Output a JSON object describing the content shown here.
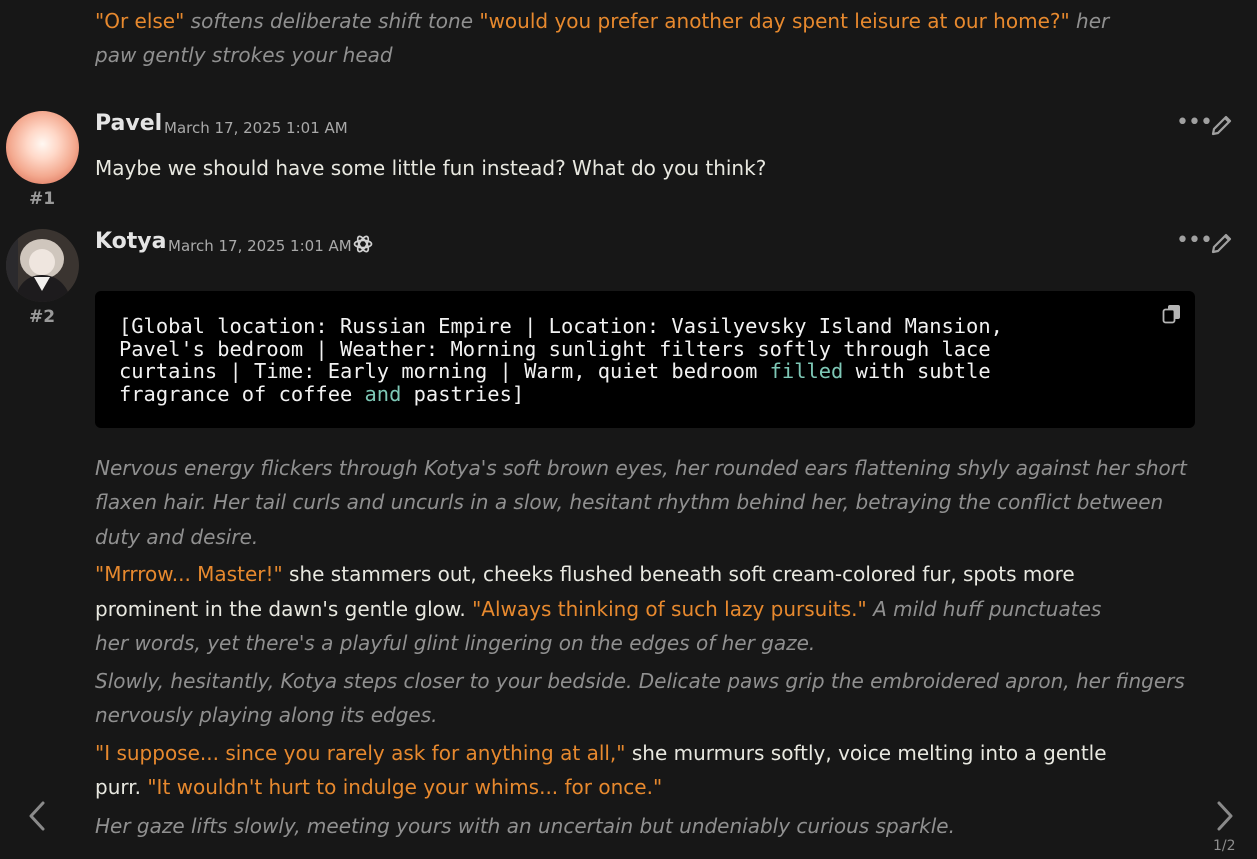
{
  "prev_message": {
    "line1": {
      "q1": "\"Or else\"",
      "n1": " softens deliberate shift tone ",
      "q2": "\"would you prefer another day spent leisure at our home?\"",
      "n2": " her"
    },
    "line2": "paw gently strokes your head"
  },
  "messages": [
    {
      "number": "#1",
      "author": "Pavel",
      "timestamp": "March 17, 2025 1:01 AM",
      "text": "Maybe we should have some little fun instead? What do you think?"
    },
    {
      "number": "#2",
      "author": "Kotya",
      "timestamp": "March 17, 2025 1:01 AM",
      "code": {
        "l1": "[Global location: Russian Empire | Location: Vasilyevsky Island Mansion,",
        "l2": "Pavel's bedroom | Weather: Morning sunlight filters softly through lace",
        "l3a": "curtains | Time: Early morning | Warm, quiet bedroom ",
        "l3b": "filled",
        "l3c": " with subtle",
        "l4a": "fragrance of coffee ",
        "l4b": "and",
        "l4c": " pastries]"
      },
      "p1": [
        "Nervous energy flickers through Kotya's soft brown eyes, her rounded ears flattening shyly against her short",
        "flaxen hair. Her tail curls and uncurls in a slow, hesitant rhythm behind her, betraying the conflict between",
        "duty and desire."
      ],
      "p2": {
        "l1q": "\"Mrrrow... Master!\"",
        "l1n": " she stammers out, cheeks flushed beneath soft cream-colored fur, spots more",
        "l2n": "prominent in the dawn's gentle glow. ",
        "l2q": "\"Always thinking of such lazy pursuits.\"",
        "l2i": " A mild huff punctuates",
        "l3i": "her words, yet there's a playful glint lingering on the edges of her gaze."
      },
      "p3": [
        "Slowly, hesitantly, Kotya steps closer to your bedside. Delicate paws grip the embroidered apron, her fingers",
        "nervously playing along its edges."
      ],
      "p4": {
        "l1q": "\"I suppose... since you rarely ask for anything at all,\"",
        "l1n": " she murmurs softly, voice melting into a gentle",
        "l2n": "purr. ",
        "l2q": "\"It wouldn't hurt to indulge your whims... for once.\""
      },
      "p5": "Her gaze lifts slowly, meeting yours with an uncertain but undeniably curious sparkle."
    }
  ],
  "swipe": {
    "counter": "1/2"
  },
  "colors": {
    "background": "#171717",
    "quote": "#e7892e",
    "narration": "#909090",
    "code_keyword": "#7ec8b6"
  }
}
